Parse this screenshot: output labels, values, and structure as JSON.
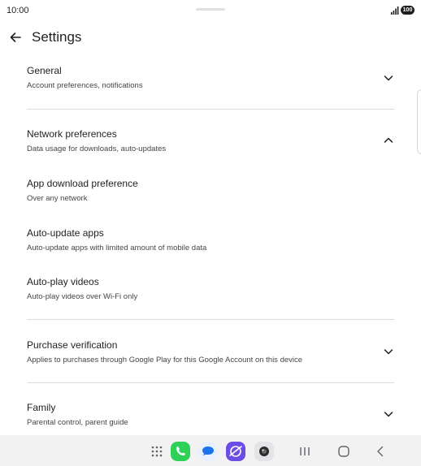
{
  "status_bar": {
    "time": "10:00",
    "battery": "100"
  },
  "app_bar": {
    "title": "Settings"
  },
  "items": [
    {
      "title": "General",
      "subtitle": "Account preferences, notifications"
    },
    {
      "title": "Network preferences",
      "subtitle": "Data usage for downloads, auto-updates"
    },
    {
      "title": "App download preference",
      "subtitle": "Over any network"
    },
    {
      "title": "Auto-update apps",
      "subtitle": "Auto-update apps with limited amount of mobile data"
    },
    {
      "title": "Auto-play videos",
      "subtitle": "Auto-play videos over Wi-Fi only"
    },
    {
      "title": "Purchase verification",
      "subtitle": "Applies to purchases through Google Play for this Google Account on this device"
    },
    {
      "title": "Family",
      "subtitle": "Parental control, parent guide"
    }
  ],
  "icons": {
    "back": "arrow-left-icon",
    "expand": "chevron-down-icon",
    "collapse": "chevron-up-icon",
    "apps": "app-grid-icon",
    "phone": "phone-app-icon",
    "messages": "messages-app-icon",
    "internet": "internet-app-icon",
    "camera": "camera-app-icon",
    "recents": "recents-icon",
    "home": "home-icon",
    "nav_back": "back-icon"
  },
  "colors": {
    "phone": "#2ed158",
    "messages": "#1a73e8",
    "internet": "#6b4ee6",
    "divider": "#dadce0",
    "nav_bg": "#f2f2f2"
  }
}
